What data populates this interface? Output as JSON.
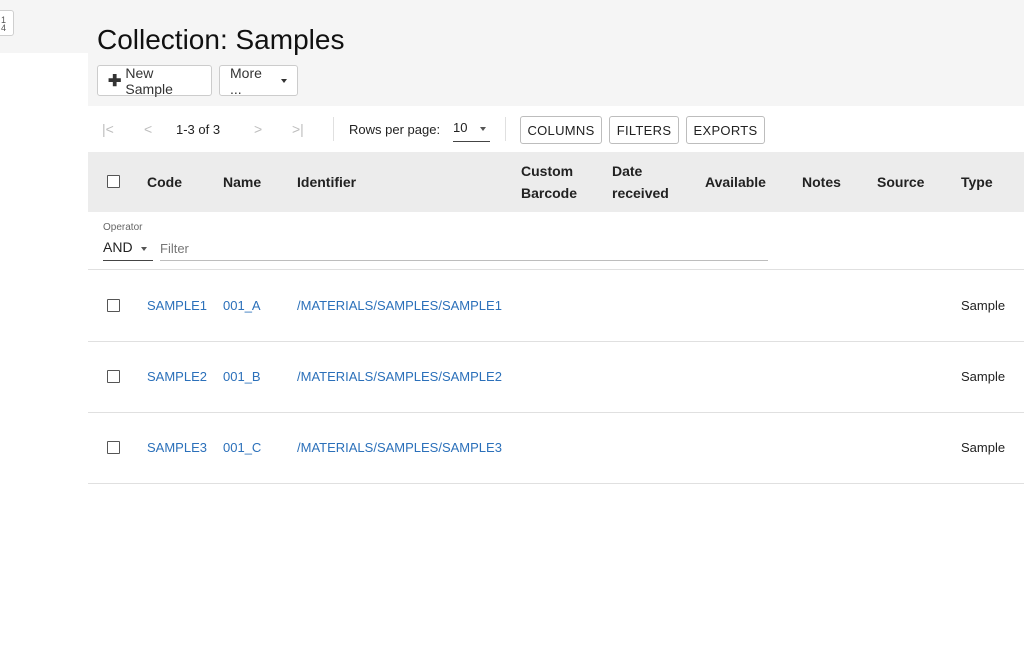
{
  "corner_button": {
    "label": "1 4"
  },
  "page": {
    "title": "Collection: Samples"
  },
  "toolbar": {
    "new_sample": "New Sample",
    "more": "More ..."
  },
  "pager": {
    "range": "1-3 of 3",
    "rows_label": "Rows per page:",
    "rows_value": "10",
    "columns_button": "COLUMNS",
    "filters_button": "FILTERS",
    "exports_button": "EXPORTS"
  },
  "table": {
    "headers": {
      "code": "Code",
      "name": "Name",
      "identifier": "Identifier",
      "custom_barcode_1": "Custom",
      "custom_barcode_2": "Barcode",
      "date_received_1": "Date",
      "date_received_2": "received",
      "available": "Available",
      "notes": "Notes",
      "source": "Source",
      "type": "Type"
    },
    "filter": {
      "operator_label": "Operator",
      "operator_value": "AND",
      "placeholder": "Filter"
    },
    "rows": [
      {
        "code": "SAMPLE1",
        "name": "001_A",
        "identifier": "/MATERIALS/SAMPLES/SAMPLE1",
        "type": "Sample"
      },
      {
        "code": "SAMPLE2",
        "name": "001_B",
        "identifier": "/MATERIALS/SAMPLES/SAMPLE2",
        "type": "Sample"
      },
      {
        "code": "SAMPLE3",
        "name": "001_C",
        "identifier": "/MATERIALS/SAMPLES/SAMPLE3",
        "type": "Sample"
      }
    ]
  },
  "colors": {
    "link": "#2b70ba",
    "header_bg": "#ececec",
    "band_bg": "#f5f5f5"
  },
  "icons": [
    "first-page-icon",
    "previous-page-icon",
    "next-page-icon",
    "last-page-icon",
    "plus-icon",
    "caret-down-icon",
    "checkbox-icon"
  ]
}
